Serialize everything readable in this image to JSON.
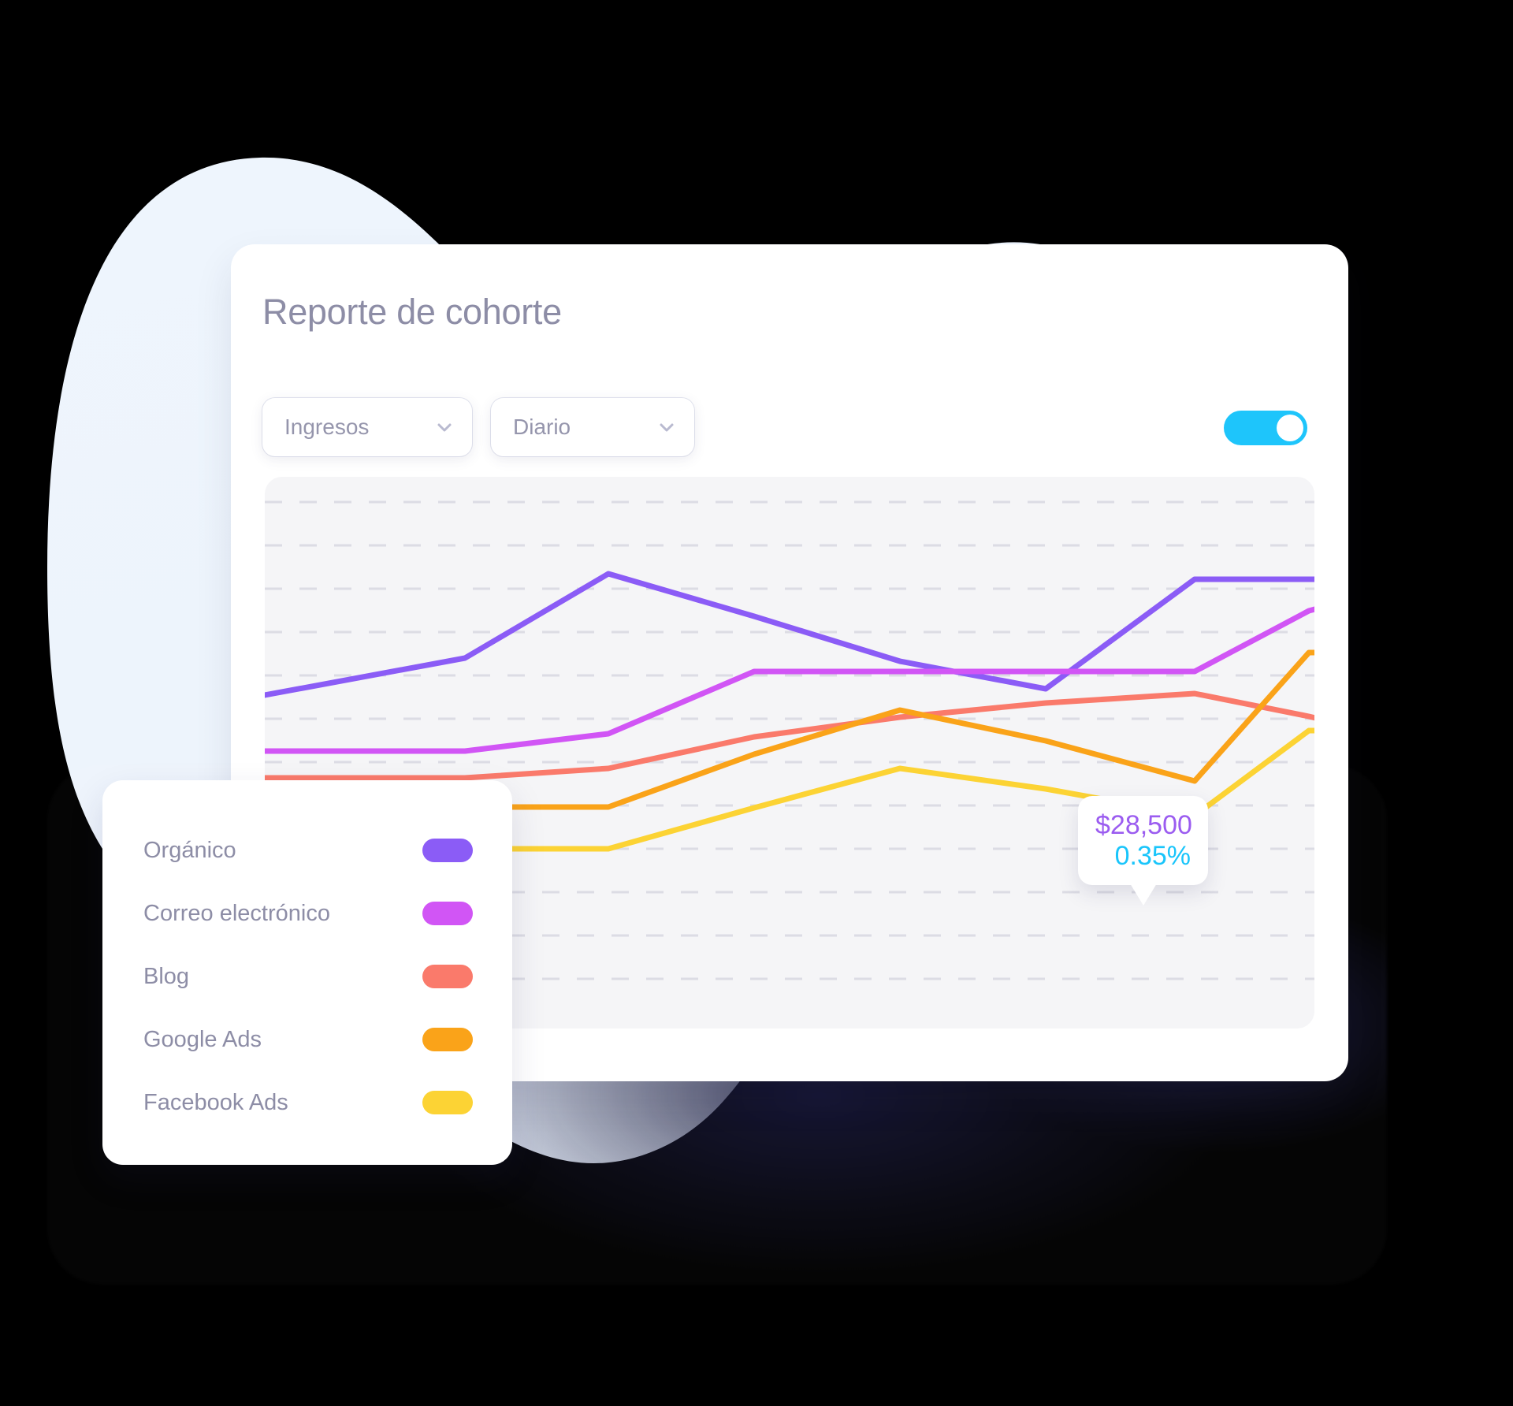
{
  "card": {
    "title": "Reporte de cohorte"
  },
  "controls": {
    "metric_select": {
      "value": "Ingresos",
      "icon": "chevron-down-icon"
    },
    "period_select": {
      "value": "Diario",
      "icon": "chevron-down-icon"
    },
    "toggle": {
      "state": "on",
      "color": "#1ec5fb"
    }
  },
  "tooltip": {
    "value": "$28,500",
    "percent": "0.35%",
    "value_color": "#9b5cf0",
    "percent_color": "#19c5fb"
  },
  "legend": {
    "items": [
      {
        "label": "Orgánico",
        "color": "#8b5cf6"
      },
      {
        "label": "Correo electrónico",
        "color": "#d155f5"
      },
      {
        "label": "Blog",
        "color": "#fa7a6b"
      },
      {
        "label": "Google Ads",
        "color": "#faa319"
      },
      {
        "label": "Facebook Ads",
        "color": "#fcd334"
      }
    ]
  },
  "chart_data": {
    "type": "line",
    "title": "Reporte de cohorte",
    "xlabel": "",
    "ylabel": "Ingresos",
    "grid": true,
    "gridlines": 12,
    "legend_position": "external-bottom-left",
    "x": [
      0,
      1,
      2,
      3,
      4,
      5,
      6,
      7,
      8
    ],
    "annotations": [
      {
        "series": "Orgánico",
        "x": 5,
        "value": "$28,500",
        "percent": "0.35%"
      }
    ],
    "series": [
      {
        "name": "Orgánico",
        "color": "#8b5cf6",
        "values": [
          30,
          42,
          63,
          55,
          47,
          41,
          62,
          76,
          76
        ]
      },
      {
        "name": "Correo electrónico",
        "color": "#d155f5",
        "values": [
          22,
          22,
          26,
          40,
          40,
          40,
          40,
          52,
          59
        ]
      },
      {
        "name": "Blog",
        "color": "#fa7a6b",
        "values": [
          18,
          18,
          20,
          26,
          30,
          33,
          35,
          31,
          28
        ]
      },
      {
        "name": "Google Ads",
        "color": "#faa319",
        "values": [
          11,
          11,
          11,
          16,
          23,
          20,
          15,
          37,
          37
        ]
      },
      {
        "name": "Facebook Ads",
        "color": "#fcd334",
        "values": [
          6,
          6,
          6,
          11,
          16,
          13,
          9,
          20,
          20
        ]
      }
    ]
  },
  "background": {
    "blob_color": "#eef5fd",
    "page_color": "#000000"
  }
}
